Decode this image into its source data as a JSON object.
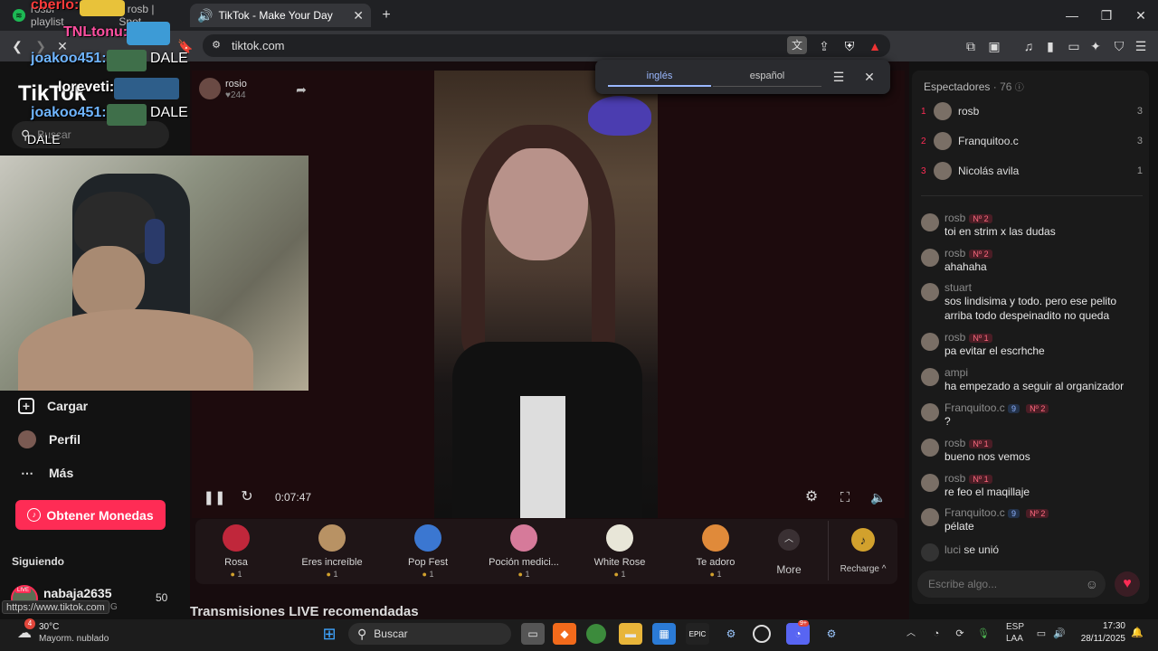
{
  "browser": {
    "tabs": [
      {
        "label": "rosbi playlist",
        "suffix": "y rosb | Spot"
      },
      {
        "label": "TikTok - Make Your Day"
      }
    ],
    "url": "tiktok.com",
    "status_url": "https://www.tiktok.com"
  },
  "overlays": {
    "line1_name": "cberlo:",
    "line2_name": "TNLtonu:",
    "line3_name": "joakoo451:",
    "line3_msg": "DALE",
    "line4_name": "loreveti:",
    "line5_name": "joakoo451:",
    "line5_msg": "DALE",
    "line6_msg": "DALE"
  },
  "nav": {
    "logo": "TikTok",
    "search_placeholder": "Buscar",
    "items": [
      {
        "label": "Cargar",
        "icon": "upload-icon"
      },
      {
        "label": "Perfil",
        "icon": "profile-icon"
      },
      {
        "label": "Más",
        "icon": "more-icon"
      }
    ],
    "coins_button": "Obtener Monedas",
    "following_heading": "Siguiendo",
    "following_user": "nabaja2635",
    "following_count": "50",
    "following_sub": "ING",
    "live_badge": "LIVE"
  },
  "stream": {
    "host_name": "rosio",
    "host_likes": "244",
    "time": "0:07:47",
    "recommended": "Transmisiones LIVE recomendadas"
  },
  "translate": {
    "tab1": "inglés",
    "tab2": "español"
  },
  "gifts": [
    {
      "name": "Rosa",
      "price": "1",
      "color": "#c0273b"
    },
    {
      "name": "Eres increíble",
      "price": "1",
      "color": "#b89264"
    },
    {
      "name": "Pop Fest",
      "price": "1",
      "color": "#3b77d1"
    },
    {
      "name": "Poción medici...",
      "price": "1",
      "color": "#d67a9a"
    },
    {
      "name": "White Rose",
      "price": "1",
      "color": "#e8e6d8"
    },
    {
      "name": "Te adoro",
      "price": "1",
      "color": "#e08a3a"
    }
  ],
  "gift_more": "More",
  "recharge": "Recharge",
  "viewers": {
    "title": "Espectadores",
    "count": "· 76",
    "list": [
      {
        "rank": "1",
        "name": "rosb",
        "score": "3"
      },
      {
        "rank": "2",
        "name": "Franquitoo.c",
        "score": "3"
      },
      {
        "rank": "3",
        "name": "Nicolás avila",
        "score": "1"
      }
    ]
  },
  "chat": [
    {
      "user": "rosb",
      "badge": "Nº 2",
      "text": "toi en strim x las dudas"
    },
    {
      "user": "rosb",
      "badge": "Nº 2",
      "text": "ahahaha"
    },
    {
      "user": "stuart",
      "badge": "",
      "text": "sos lindisima y todo. pero ese pelito arriba todo despeinadito no queda"
    },
    {
      "user": "rosb",
      "badge": "Nº 1",
      "text": "pa evitar el escrhche"
    },
    {
      "user": "ampi",
      "badge": "",
      "text": "ha empezado a seguir al organizador"
    },
    {
      "user": "Franquitoo.c",
      "badge": "Nº 2",
      "level": "9",
      "text": "?"
    },
    {
      "user": "rosb",
      "badge": "Nº 1",
      "text": "bueno nos vemos"
    },
    {
      "user": "rosb",
      "badge": "Nº 1",
      "text": "re feo el maqillaje"
    },
    {
      "user": "Franquitoo.c",
      "badge": "Nº 2",
      "level": "9",
      "text": "pélate"
    },
    {
      "user": "luci",
      "badge": "",
      "text": "se unió"
    }
  ],
  "chat_input_placeholder": "Escribe algo...",
  "taskbar": {
    "weather_temp": "30°C",
    "weather_desc": "Mayorm. nublado",
    "weather_badge": "4",
    "search_label": "Buscar",
    "lang1": "ESP",
    "lang2": "LAA",
    "time": "17:30",
    "date": "28/11/2025",
    "discord_badge": "9+"
  }
}
